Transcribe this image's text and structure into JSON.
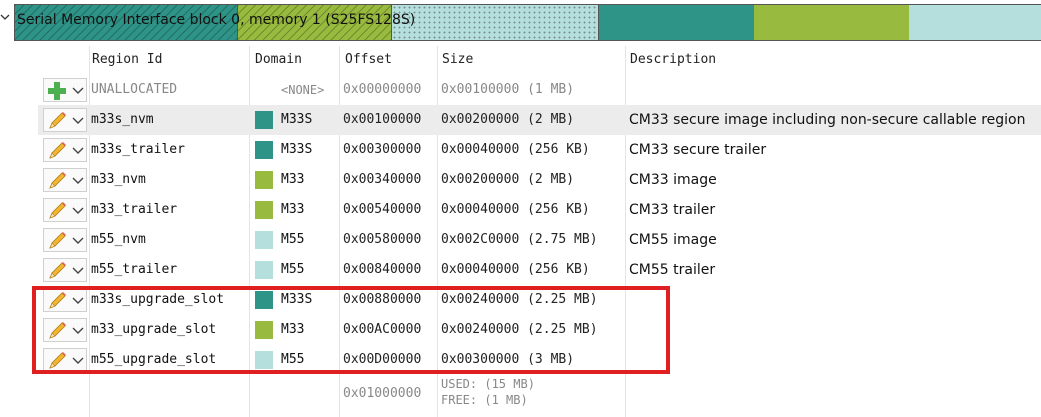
{
  "memory_map": {
    "label": "Serial Memory Interface block 0, memory 1 (S25FS128S)"
  },
  "columns": {
    "region_id": "Region Id",
    "domain": "Domain",
    "offset": "Offset",
    "size": "Size",
    "description": "Description"
  },
  "unallocated": {
    "id": "UNALLOCATED",
    "domain": "<NONE>",
    "offset": "0x00000000",
    "size": "0x00100000 (1 MB)",
    "description": ""
  },
  "regions": [
    {
      "id": "m33s_nvm",
      "domain": "M33S",
      "color": "#2f9488",
      "offset": "0x00100000",
      "size": "0x00200000 (2 MB)",
      "description": "CM33 secure image including non-secure callable region"
    },
    {
      "id": "m33s_trailer",
      "domain": "M33S",
      "color": "#2f9488",
      "offset": "0x00300000",
      "size": "0x00040000 (256 KB)",
      "description": "CM33 secure trailer"
    },
    {
      "id": "m33_nvm",
      "domain": "M33",
      "color": "#98ba3e",
      "offset": "0x00340000",
      "size": "0x00200000 (2 MB)",
      "description": "CM33 image"
    },
    {
      "id": "m33_trailer",
      "domain": "M33",
      "color": "#98ba3e",
      "offset": "0x00540000",
      "size": "0x00040000 (256 KB)",
      "description": "CM33 trailer"
    },
    {
      "id": "m55_nvm",
      "domain": "M55",
      "color": "#b5dfdc",
      "offset": "0x00580000",
      "size": "0x002C0000 (2.75 MB)",
      "description": "CM55 image"
    },
    {
      "id": "m55_trailer",
      "domain": "M55",
      "color": "#b5dfdc",
      "offset": "0x00840000",
      "size": "0x00040000 (256 KB)",
      "description": "CM55 trailer"
    },
    {
      "id": "m33s_upgrade_slot",
      "domain": "M33S",
      "color": "#2f9488",
      "offset": "0x00880000",
      "size": "0x00240000 (2.25 MB)",
      "description": ""
    },
    {
      "id": "m33_upgrade_slot",
      "domain": "M33",
      "color": "#98ba3e",
      "offset": "0x00AC0000",
      "size": "0x00240000 (2.25 MB)",
      "description": ""
    },
    {
      "id": "m55_upgrade_slot",
      "domain": "M55",
      "color": "#b5dfdc",
      "offset": "0x00D00000",
      "size": "0x00300000 (3 MB)",
      "description": ""
    }
  ],
  "footer": {
    "offset": "0x01000000",
    "used": "USED: (15 MB)",
    "free": "FREE: (1 MB)"
  }
}
